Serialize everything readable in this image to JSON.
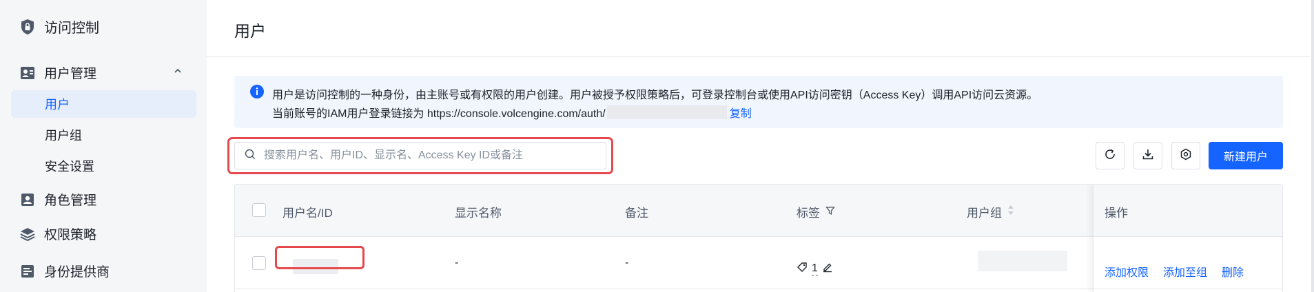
{
  "sidebar": {
    "top_item": {
      "label": "访问控制",
      "icon": "shield-lock-icon"
    },
    "groups": [
      {
        "label": "用户管理",
        "icon": "user-manage-icon",
        "expanded": true,
        "items": [
          {
            "label": "用户",
            "active": true
          },
          {
            "label": "用户组",
            "active": false
          },
          {
            "label": "安全设置",
            "active": false
          }
        ]
      },
      {
        "label": "角色管理",
        "icon": "role-icon"
      },
      {
        "label": "权限策略",
        "icon": "layers-icon"
      },
      {
        "label": "身份提供商",
        "icon": "id-provider-icon"
      }
    ]
  },
  "main": {
    "title": "用户",
    "info": {
      "line1": "用户是访问控制的一种身份，由主账号或有权限的用户创建。用户被授予权限策略后，可登录控制台或使用API访问密钥（Access Key）调用API访问云资源。",
      "line2_prefix": "当前账号的IAM用户登录链接为 https://console.volcengine.com/auth/",
      "copy_label": "复制"
    },
    "search": {
      "placeholder": "搜索用户名、用户ID、显示名、Access Key ID或备注"
    },
    "toolbar": {
      "refresh_icon": "refresh-icon",
      "download_icon": "download-icon",
      "settings_icon": "gear-icon",
      "create_label": "新建用户"
    },
    "table": {
      "columns": {
        "username": "用户名/ID",
        "display_name": "显示名称",
        "remark": "备注",
        "tags": "标签",
        "group": "用户组",
        "ops": "操作"
      },
      "rows": [
        {
          "display_name": "-",
          "remark": "-",
          "tag_count": "1",
          "ops": [
            "添加权限",
            "添加至组",
            "删除"
          ]
        }
      ]
    }
  },
  "colors": {
    "accent": "#1664ff",
    "highlight": "#e5484d",
    "sidebar_bg": "#f5f6f8",
    "info_bg": "#f0f5fe"
  }
}
